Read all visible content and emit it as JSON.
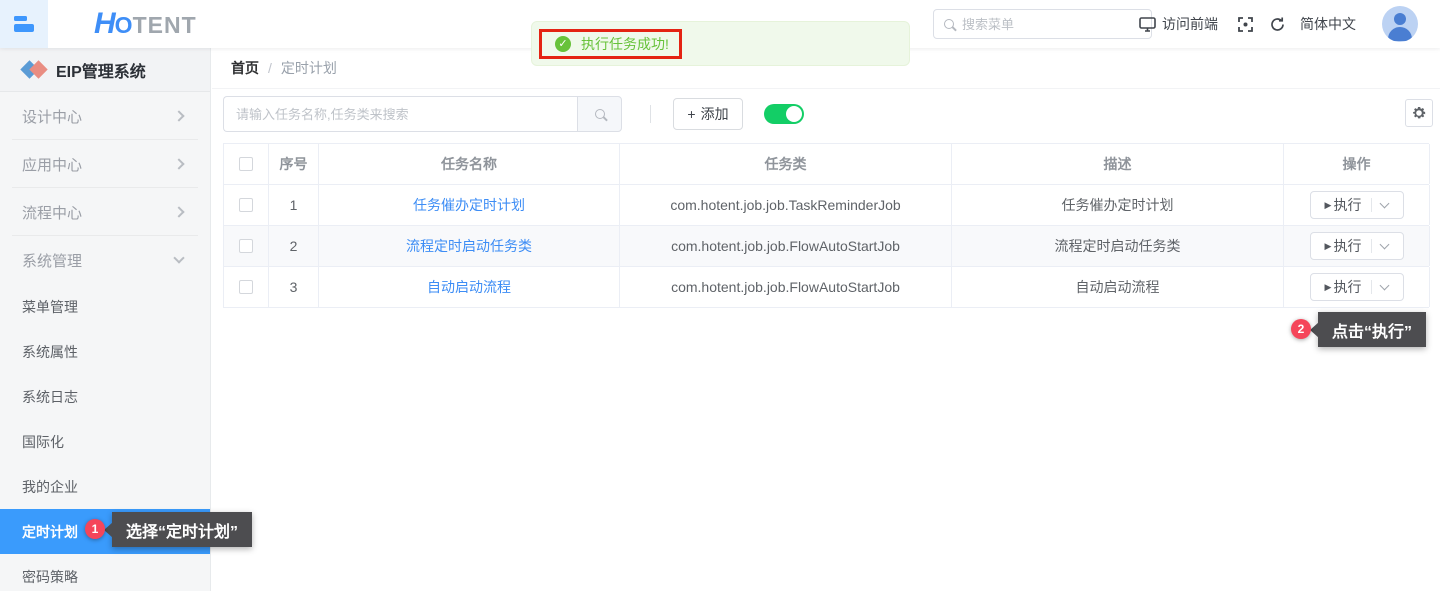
{
  "header": {
    "logo": {
      "h": "H",
      "o": "O",
      "rest": "TENT"
    },
    "search_placeholder": "搜索菜单",
    "visit_frontend": "访问前端",
    "language": "简体中文"
  },
  "toast": {
    "message": "执行任务成功!"
  },
  "sidebar": {
    "system_title": "EIP管理系统",
    "groups": [
      {
        "label": "设计中心"
      },
      {
        "label": "应用中心"
      },
      {
        "label": "流程中心"
      },
      {
        "label": "系统管理"
      }
    ],
    "submenu": [
      {
        "label": "菜单管理"
      },
      {
        "label": "系统属性"
      },
      {
        "label": "系统日志"
      },
      {
        "label": "国际化"
      },
      {
        "label": "我的企业"
      },
      {
        "label": "定时计划"
      },
      {
        "label": "密码策略"
      }
    ],
    "active_item": "定时计划"
  },
  "breadcrumb": {
    "home": "首页",
    "separator": "/",
    "current": "定时计划"
  },
  "toolbar": {
    "search_placeholder": "请输入任务名称,任务类来搜索",
    "add_plus": "+",
    "add_label": "添加",
    "toggle_state": "on"
  },
  "table": {
    "columns": {
      "index": "序号",
      "name": "任务名称",
      "job_class": "任务类",
      "description": "描述",
      "actions": "操作"
    },
    "rows": [
      {
        "index": "1",
        "name": "任务催办定时计划",
        "job_class": "com.hotent.job.job.TaskReminderJob",
        "description": "任务催办定时计划",
        "action": "执行"
      },
      {
        "index": "2",
        "name": "流程定时启动任务类",
        "job_class": "com.hotent.job.job.FlowAutoStartJob",
        "description": "流程定时启动任务类",
        "action": "执行"
      },
      {
        "index": "3",
        "name": "自动启动流程",
        "job_class": "com.hotent.job.job.FlowAutoStartJob",
        "description": "自动启动流程",
        "action": "执行"
      }
    ]
  },
  "annotations": {
    "step1": {
      "number": "1",
      "label": "选择“定时计划”"
    },
    "step2": {
      "number": "2",
      "label": "点击“执行”"
    }
  },
  "colors": {
    "primary_blue": "#3a9bfc",
    "link_blue": "#3d8df5",
    "success_green": "#67c23a",
    "toggle_green": "#13ce66",
    "annotation_red": "#f5455a",
    "highlight_rect_red": "#e42313",
    "tooltip_dark": "#4d4d50"
  }
}
